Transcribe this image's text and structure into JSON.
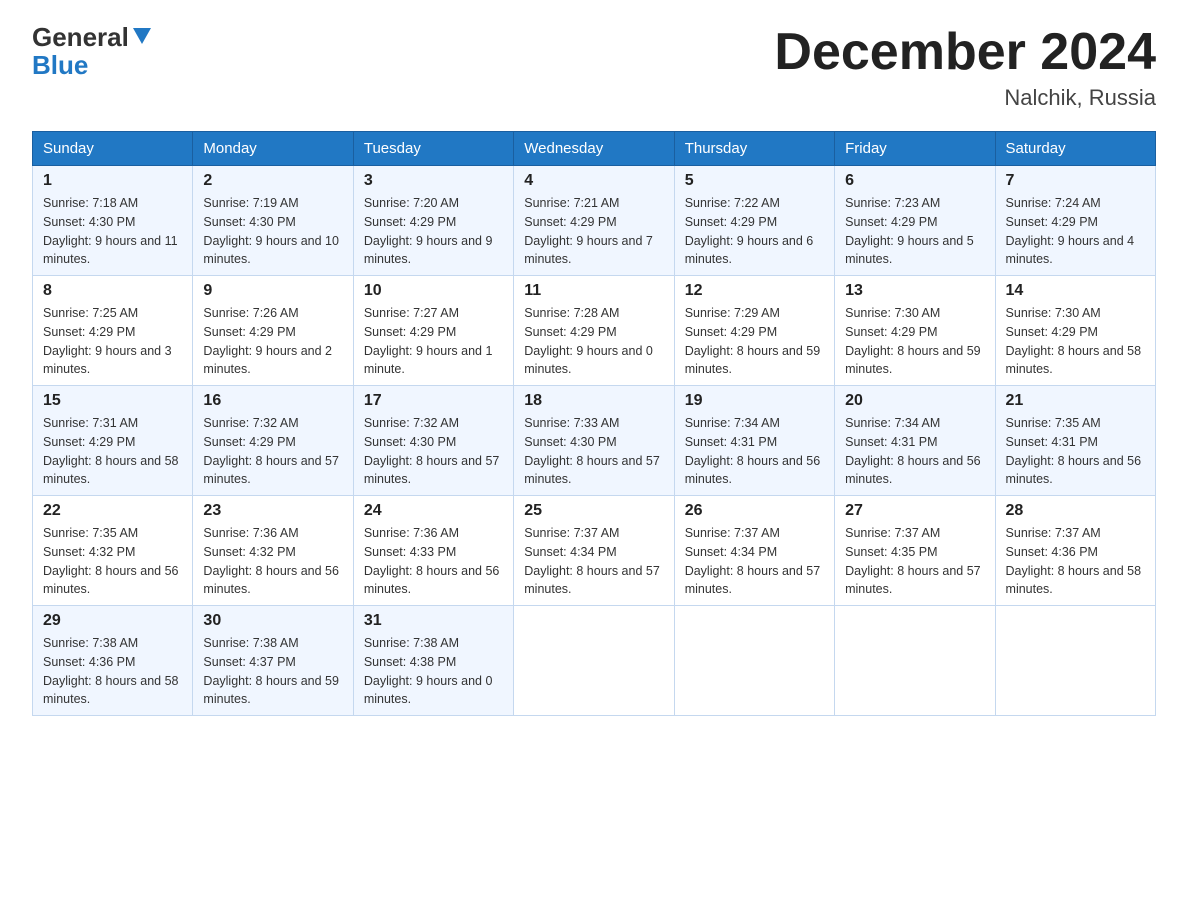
{
  "header": {
    "logo_line1": "General",
    "logo_line2": "Blue",
    "month_title": "December 2024",
    "location": "Nalchik, Russia"
  },
  "weekdays": [
    "Sunday",
    "Monday",
    "Tuesday",
    "Wednesday",
    "Thursday",
    "Friday",
    "Saturday"
  ],
  "weeks": [
    [
      {
        "day": "1",
        "sunrise": "7:18 AM",
        "sunset": "4:30 PM",
        "daylight": "9 hours and 11 minutes."
      },
      {
        "day": "2",
        "sunrise": "7:19 AM",
        "sunset": "4:30 PM",
        "daylight": "9 hours and 10 minutes."
      },
      {
        "day": "3",
        "sunrise": "7:20 AM",
        "sunset": "4:29 PM",
        "daylight": "9 hours and 9 minutes."
      },
      {
        "day": "4",
        "sunrise": "7:21 AM",
        "sunset": "4:29 PM",
        "daylight": "9 hours and 7 minutes."
      },
      {
        "day": "5",
        "sunrise": "7:22 AM",
        "sunset": "4:29 PM",
        "daylight": "9 hours and 6 minutes."
      },
      {
        "day": "6",
        "sunrise": "7:23 AM",
        "sunset": "4:29 PM",
        "daylight": "9 hours and 5 minutes."
      },
      {
        "day": "7",
        "sunrise": "7:24 AM",
        "sunset": "4:29 PM",
        "daylight": "9 hours and 4 minutes."
      }
    ],
    [
      {
        "day": "8",
        "sunrise": "7:25 AM",
        "sunset": "4:29 PM",
        "daylight": "9 hours and 3 minutes."
      },
      {
        "day": "9",
        "sunrise": "7:26 AM",
        "sunset": "4:29 PM",
        "daylight": "9 hours and 2 minutes."
      },
      {
        "day": "10",
        "sunrise": "7:27 AM",
        "sunset": "4:29 PM",
        "daylight": "9 hours and 1 minute."
      },
      {
        "day": "11",
        "sunrise": "7:28 AM",
        "sunset": "4:29 PM",
        "daylight": "9 hours and 0 minutes."
      },
      {
        "day": "12",
        "sunrise": "7:29 AM",
        "sunset": "4:29 PM",
        "daylight": "8 hours and 59 minutes."
      },
      {
        "day": "13",
        "sunrise": "7:30 AM",
        "sunset": "4:29 PM",
        "daylight": "8 hours and 59 minutes."
      },
      {
        "day": "14",
        "sunrise": "7:30 AM",
        "sunset": "4:29 PM",
        "daylight": "8 hours and 58 minutes."
      }
    ],
    [
      {
        "day": "15",
        "sunrise": "7:31 AM",
        "sunset": "4:29 PM",
        "daylight": "8 hours and 58 minutes."
      },
      {
        "day": "16",
        "sunrise": "7:32 AM",
        "sunset": "4:29 PM",
        "daylight": "8 hours and 57 minutes."
      },
      {
        "day": "17",
        "sunrise": "7:32 AM",
        "sunset": "4:30 PM",
        "daylight": "8 hours and 57 minutes."
      },
      {
        "day": "18",
        "sunrise": "7:33 AM",
        "sunset": "4:30 PM",
        "daylight": "8 hours and 57 minutes."
      },
      {
        "day": "19",
        "sunrise": "7:34 AM",
        "sunset": "4:31 PM",
        "daylight": "8 hours and 56 minutes."
      },
      {
        "day": "20",
        "sunrise": "7:34 AM",
        "sunset": "4:31 PM",
        "daylight": "8 hours and 56 minutes."
      },
      {
        "day": "21",
        "sunrise": "7:35 AM",
        "sunset": "4:31 PM",
        "daylight": "8 hours and 56 minutes."
      }
    ],
    [
      {
        "day": "22",
        "sunrise": "7:35 AM",
        "sunset": "4:32 PM",
        "daylight": "8 hours and 56 minutes."
      },
      {
        "day": "23",
        "sunrise": "7:36 AM",
        "sunset": "4:32 PM",
        "daylight": "8 hours and 56 minutes."
      },
      {
        "day": "24",
        "sunrise": "7:36 AM",
        "sunset": "4:33 PM",
        "daylight": "8 hours and 56 minutes."
      },
      {
        "day": "25",
        "sunrise": "7:37 AM",
        "sunset": "4:34 PM",
        "daylight": "8 hours and 57 minutes."
      },
      {
        "day": "26",
        "sunrise": "7:37 AM",
        "sunset": "4:34 PM",
        "daylight": "8 hours and 57 minutes."
      },
      {
        "day": "27",
        "sunrise": "7:37 AM",
        "sunset": "4:35 PM",
        "daylight": "8 hours and 57 minutes."
      },
      {
        "day": "28",
        "sunrise": "7:37 AM",
        "sunset": "4:36 PM",
        "daylight": "8 hours and 58 minutes."
      }
    ],
    [
      {
        "day": "29",
        "sunrise": "7:38 AM",
        "sunset": "4:36 PM",
        "daylight": "8 hours and 58 minutes."
      },
      {
        "day": "30",
        "sunrise": "7:38 AM",
        "sunset": "4:37 PM",
        "daylight": "8 hours and 59 minutes."
      },
      {
        "day": "31",
        "sunrise": "7:38 AM",
        "sunset": "4:38 PM",
        "daylight": "9 hours and 0 minutes."
      },
      null,
      null,
      null,
      null
    ]
  ]
}
